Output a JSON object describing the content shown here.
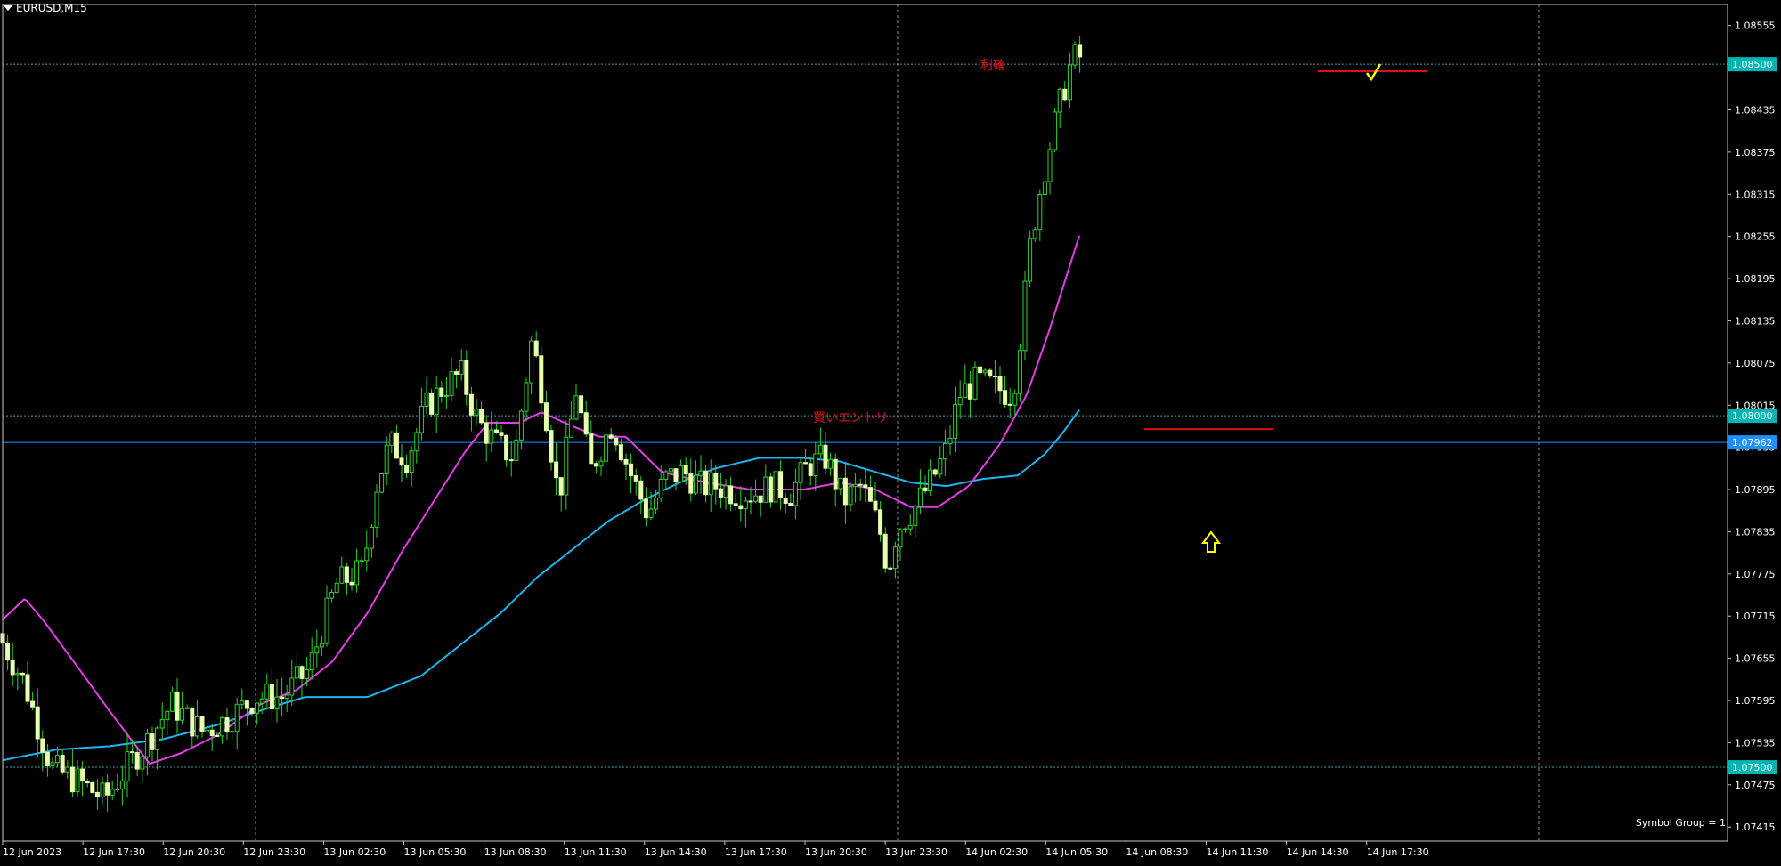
{
  "window": {
    "symbol_label": "EURUSD,M15",
    "footer_note": "Symbol Group = 1"
  },
  "colors": {
    "background": "#000000",
    "grid": "#c8c8c8",
    "frame": "#c8c8c8",
    "bull_candle_body": "#e8ffb0",
    "candle_wick": "#2bd42b",
    "ma_fast": "#e63ce6",
    "ma_slow": "#1eb4f0",
    "hline_blue": "#1e90ff",
    "price_tag_blue": "#1e90ff",
    "price_tag_teal": "#00b4b4",
    "annotation_red": "#e01010",
    "arrow_yellow": "#ffff00"
  },
  "chart_data": {
    "type": "candlestick",
    "title": "EURUSD,M15",
    "x_tick_labels": [
      "12 Jun 2023",
      "12 Jun 17:30",
      "12 Jun 20:30",
      "12 Jun 23:30",
      "13 Jun 02:30",
      "13 Jun 05:30",
      "13 Jun 08:30",
      "13 Jun 11:30",
      "13 Jun 14:30",
      "13 Jun 17:30",
      "13 Jun 20:30",
      "13 Jun 23:30",
      "14 Jun 02:30",
      "14 Jun 05:30",
      "14 Jun 08:30",
      "14 Jun 11:30",
      "14 Jun 14:30",
      "14 Jun 17:30"
    ],
    "y_tick_labels": [
      "1.08555",
      "1.08495",
      "1.08435",
      "1.08375",
      "1.08315",
      "1.08255",
      "1.08195",
      "1.08135",
      "1.08075",
      "1.08015",
      "1.07955",
      "1.07895",
      "1.07835",
      "1.07775",
      "1.07715",
      "1.07655",
      "1.07595",
      "1.07535",
      "1.07475",
      "1.07415"
    ],
    "ylim": [
      1.07395,
      1.08585
    ],
    "price_tags": [
      {
        "value": 1.085,
        "label": "1.08500",
        "style": "teal"
      },
      {
        "value": 1.08,
        "label": "1.08000",
        "style": "teal"
      },
      {
        "value": 1.07962,
        "label": "1.07962",
        "style": "blue"
      },
      {
        "value": 1.075,
        "label": "1.07500",
        "style": "teal"
      }
    ],
    "horizontal_lines": [
      {
        "value": 1.085,
        "style": "dotted"
      },
      {
        "value": 1.08,
        "style": "dotted"
      },
      {
        "value": 1.07962,
        "style": "solid"
      },
      {
        "value": 1.075,
        "style": "dotted"
      }
    ],
    "annotations": [
      {
        "text": "買いエントリー",
        "price": 1.07981,
        "label_time_index": 1010
      },
      {
        "text": "利確",
        "price": 1.0849,
        "label_time_index": 1138
      }
    ],
    "ohlc_keypoints": [
      [
        0,
        1.0769
      ],
      [
        30,
        1.0762
      ],
      [
        60,
        1.075
      ],
      [
        90,
        1.0748
      ],
      [
        120,
        1.07455
      ],
      [
        145,
        1.075
      ],
      [
        170,
        1.0754
      ],
      [
        195,
        1.0759
      ],
      [
        230,
        1.0755
      ],
      [
        260,
        1.0757
      ],
      [
        290,
        1.076
      ],
      [
        320,
        1.076
      ],
      [
        350,
        1.0764
      ],
      [
        380,
        1.0776
      ],
      [
        410,
        1.0778
      ],
      [
        425,
        1.079
      ],
      [
        440,
        1.0796
      ],
      [
        460,
        1.0794
      ],
      [
        480,
        1.0801
      ],
      [
        500,
        1.0804
      ],
      [
        520,
        1.0806
      ],
      [
        540,
        1.0799
      ],
      [
        560,
        1.0796
      ],
      [
        580,
        1.0794
      ],
      [
        600,
        1.0811
      ],
      [
        615,
        1.0801
      ],
      [
        630,
        1.0788
      ],
      [
        650,
        1.0804
      ],
      [
        665,
        1.0792
      ],
      [
        690,
        1.0799
      ],
      [
        710,
        1.0792
      ],
      [
        730,
        1.0786
      ],
      [
        750,
        1.0791
      ],
      [
        770,
        1.0792
      ],
      [
        790,
        1.079
      ],
      [
        810,
        1.079
      ],
      [
        830,
        1.0789
      ],
      [
        850,
        1.0789
      ],
      [
        870,
        1.079
      ],
      [
        890,
        1.0789
      ],
      [
        910,
        1.0793
      ],
      [
        930,
        1.0794
      ],
      [
        950,
        1.0788
      ],
      [
        970,
        1.079
      ],
      [
        990,
        1.0784
      ],
      [
        1000,
        1.0778
      ],
      [
        1010,
        1.0784
      ],
      [
        1030,
        1.0787
      ],
      [
        1050,
        1.0791
      ],
      [
        1065,
        1.0795
      ],
      [
        1080,
        1.0803
      ],
      [
        1100,
        1.0805
      ],
      [
        1120,
        1.0804
      ],
      [
        1140,
        1.0803
      ],
      [
        1150,
        1.0813
      ],
      [
        1160,
        1.0825
      ],
      [
        1175,
        1.0835
      ],
      [
        1190,
        1.0843
      ],
      [
        1205,
        1.085
      ],
      [
        1210,
        1.0851
      ]
    ],
    "ma_fast_keypoints": [
      [
        0,
        1.0771
      ],
      [
        25,
        1.0774
      ],
      [
        45,
        1.0771
      ],
      [
        80,
        1.0765
      ],
      [
        120,
        1.0758
      ],
      [
        165,
        1.07505
      ],
      [
        200,
        1.0752
      ],
      [
        240,
        1.07545
      ],
      [
        290,
        1.0759
      ],
      [
        330,
        1.0761
      ],
      [
        370,
        1.0765
      ],
      [
        410,
        1.0772
      ],
      [
        450,
        1.0781
      ],
      [
        490,
        1.0789
      ],
      [
        520,
        1.0795
      ],
      [
        545,
        1.0799
      ],
      [
        580,
        1.0799
      ],
      [
        605,
        1.08005
      ],
      [
        640,
        1.07985
      ],
      [
        670,
        1.0797
      ],
      [
        700,
        1.0797
      ],
      [
        740,
        1.0792
      ],
      [
        790,
        1.07905
      ],
      [
        840,
        1.07895
      ],
      [
        900,
        1.07895
      ],
      [
        940,
        1.07905
      ],
      [
        980,
        1.07895
      ],
      [
        1020,
        1.0787
      ],
      [
        1050,
        1.0787
      ],
      [
        1085,
        1.079
      ],
      [
        1120,
        1.0796
      ],
      [
        1150,
        1.0803
      ],
      [
        1175,
        1.0812
      ],
      [
        1195,
        1.082
      ],
      [
        1210,
        1.0826
      ]
    ],
    "ma_slow_keypoints": [
      [
        0,
        1.0751
      ],
      [
        60,
        1.07525
      ],
      [
        120,
        1.0753
      ],
      [
        180,
        1.0754
      ],
      [
        240,
        1.0756
      ],
      [
        300,
        1.07585
      ],
      [
        340,
        1.076
      ],
      [
        410,
        1.076
      ],
      [
        470,
        1.0763
      ],
      [
        520,
        1.0768
      ],
      [
        560,
        1.0772
      ],
      [
        600,
        1.0777
      ],
      [
        640,
        1.0781
      ],
      [
        680,
        1.0785
      ],
      [
        720,
        1.0788
      ],
      [
        760,
        1.07905
      ],
      [
        800,
        1.07925
      ],
      [
        850,
        1.0794
      ],
      [
        900,
        1.0794
      ],
      [
        940,
        1.07935
      ],
      [
        980,
        1.0792
      ],
      [
        1020,
        1.07905
      ],
      [
        1060,
        1.079
      ],
      [
        1100,
        1.0791
      ],
      [
        1140,
        1.07915
      ],
      [
        1170,
        1.07945
      ],
      [
        1190,
        1.07975
      ],
      [
        1210,
        1.0801
      ]
    ]
  }
}
